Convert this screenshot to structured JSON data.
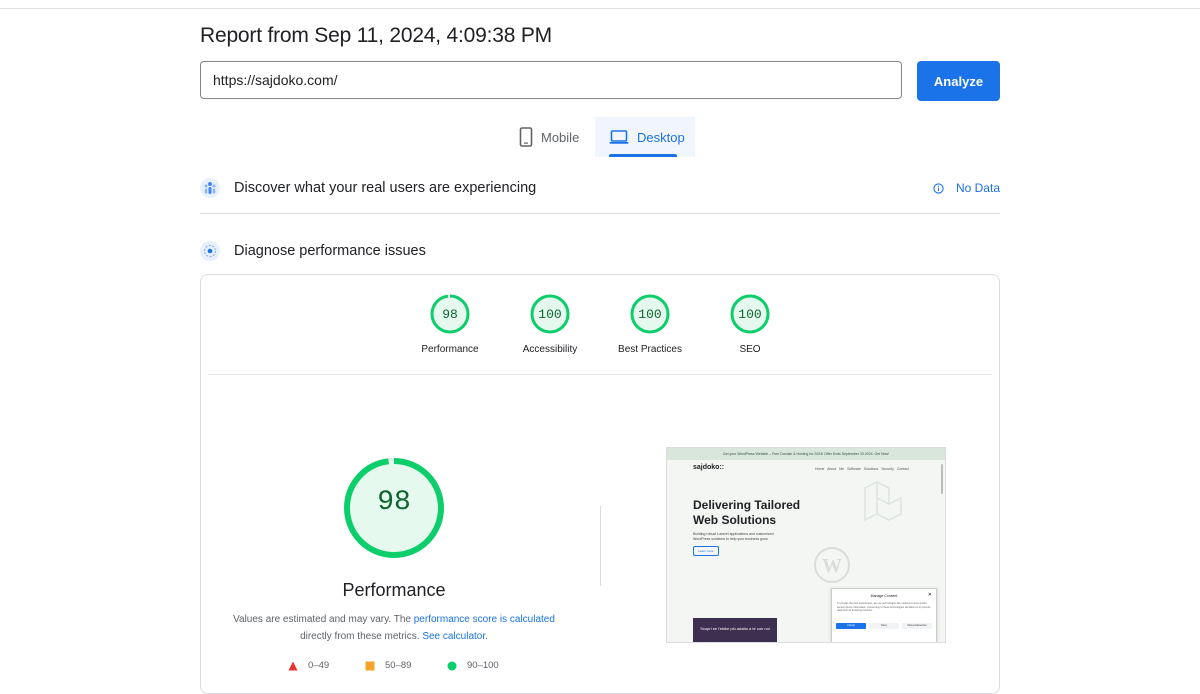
{
  "header": {
    "title": "Report from Sep 11, 2024, 4:09:38 PM"
  },
  "url_bar": {
    "value": "https://sajdoko.com/",
    "analyze_label": "Analyze"
  },
  "tabs": [
    {
      "label": "Mobile",
      "icon": "smartphone-icon",
      "selected": false
    },
    {
      "label": "Desktop",
      "icon": "laptop-icon",
      "selected": true
    }
  ],
  "real_users": {
    "title": "Discover what your real users are experiencing",
    "status": "No Data",
    "icon": "users-icon"
  },
  "diagnose": {
    "title": "Diagnose performance issues",
    "icon": "target-icon"
  },
  "scores": [
    {
      "label": "Performance",
      "value": "98"
    },
    {
      "label": "Accessibility",
      "value": "100"
    },
    {
      "label": "Best Practices",
      "value": "100"
    },
    {
      "label": "SEO",
      "value": "100"
    }
  ],
  "performance": {
    "value": "98",
    "label": "Performance",
    "note_before": "Values are estimated and may vary. The ",
    "note_link": "performance score is calculated",
    "note_middle": " directly from these metrics. ",
    "note_link2": "See calculator."
  },
  "legend": [
    {
      "range": "0–49",
      "color": "#e8332b",
      "shape": "triangle"
    },
    {
      "range": "50–89",
      "color": "#f4a32b",
      "shape": "square"
    },
    {
      "range": "90–100",
      "color": "#0cce6b",
      "shape": "circle"
    }
  ],
  "screenshot": {
    "banner": "Get your WordPress Website – Free Domain & Hosting for 2024! Offer Ends September 30 2024. Get Now!",
    "brand": "sajdoko::",
    "nav": "Home  About Me  Software Solutions  Security  Contact",
    "heading": "Delivering Tailored Web Solutions",
    "sub": "Building robust Laravel applications and customized WordPress solutions to help your business grow.",
    "learn": "Learn more",
    "dark_text": "Scopri se l'ebike più adatto a te con noi",
    "consent_title": "Manage Consent",
    "consent_body": "To provide the best experiences, we use technologies like cookies to store and/or access device information. Consenting to these technologies will allow us to process data such as browsing behavior.",
    "consent_accept": "Accept",
    "consent_deny": "Deny",
    "consent_prefs": "View preferences"
  },
  "colors": {
    "accent": "#1a73e8",
    "good": "#0cce6b",
    "good_text": "#0d652d",
    "good_bg": "#e6f9ef"
  }
}
